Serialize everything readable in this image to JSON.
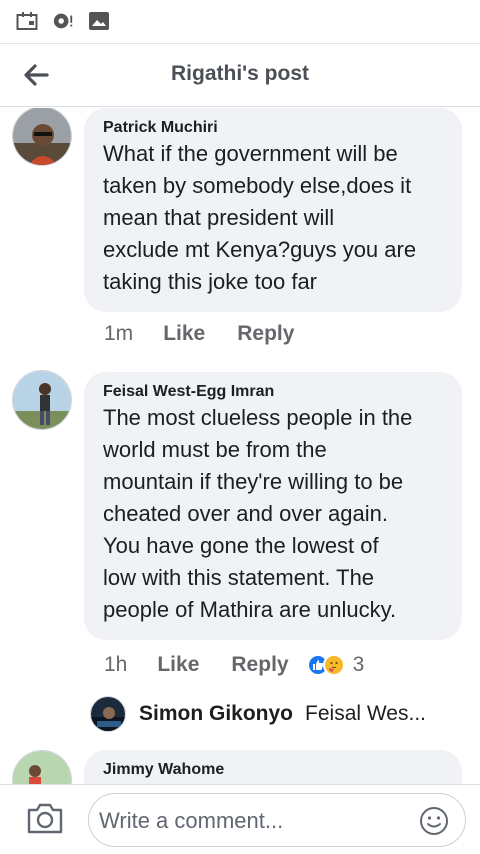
{
  "header": {
    "title": "Rigathi's post"
  },
  "comments": [
    {
      "author": "Patrick Muchiri",
      "lines": [
        "What if the government will be",
        "taken by somebody else,does it",
        "mean that president will",
        "exclude mt Kenya?guys you are",
        "taking this joke too far"
      ],
      "time": "1m",
      "like": "Like",
      "reply": "Reply"
    },
    {
      "author": "Feisal West-Egg Imran",
      "lines": [
        "The most clueless people in the",
        "world must be from the",
        "mountain if they're willing to be",
        "cheated over and over again.",
        "You have gone the lowest of",
        "low with this statement. The",
        "people of Mathira are unlucky."
      ],
      "time": "1h",
      "like": "Like",
      "reply": "Reply",
      "reaction_count": "3",
      "reactions": [
        "like-icon",
        "care-icon"
      ],
      "reply_preview": {
        "author": "Simon Gikonyo",
        "text": "Feisal Wes..."
      }
    },
    {
      "author": "Jimmy Wahome"
    }
  ],
  "composer": {
    "placeholder": "Write a comment..."
  },
  "colors": {
    "like_blue": "#1877f2",
    "bubble_bg": "#f0f2f5"
  }
}
